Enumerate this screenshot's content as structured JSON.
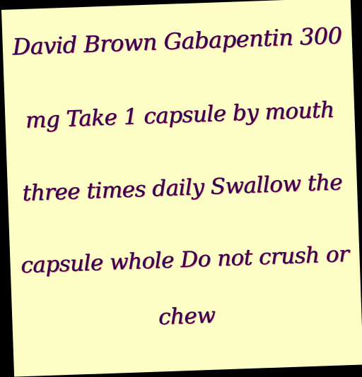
{
  "note": {
    "lines": [
      "David Brown Gabapentin 300",
      "mg Take 1 capsule by mouth",
      "three times daily Swallow the",
      "capsule whole Do not crush or",
      "chew"
    ]
  },
  "colors": {
    "paper": "#fdfdc6",
    "ink": "#2a0a50",
    "background": "#000000"
  }
}
